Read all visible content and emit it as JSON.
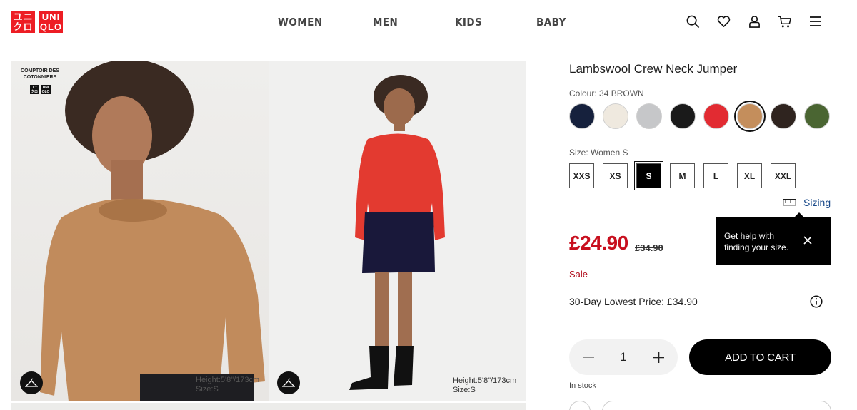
{
  "brand": {
    "logo_left": [
      "ユニ",
      "クロ"
    ],
    "logo_right": [
      "UNI",
      "QLO"
    ]
  },
  "nav": {
    "items": [
      "WOMEN",
      "MEN",
      "KIDS",
      "BABY"
    ]
  },
  "header_icons": [
    "search-icon",
    "heart-icon",
    "account-icon",
    "cart-icon",
    "menu-icon"
  ],
  "gallery": {
    "left_badge": "COMPTOIR DES COTONNIERS",
    "left_caption": [
      "Height:5'8\"/173cm",
      "Size:S"
    ],
    "right_caption": [
      "Height:5'8\"/173cm",
      "Size:S"
    ]
  },
  "product": {
    "title": "Lambswool Crew Neck Jumper",
    "colour_label": "Colour: 34 BROWN",
    "colours": [
      {
        "name": "navy",
        "hex": "#16213d"
      },
      {
        "name": "off-white",
        "hex": "#efe9df"
      },
      {
        "name": "grey",
        "hex": "#c6c7c9"
      },
      {
        "name": "black",
        "hex": "#1a1a1a"
      },
      {
        "name": "red",
        "hex": "#e22b32"
      },
      {
        "name": "brown",
        "hex": "#c48e5c",
        "selected": true
      },
      {
        "name": "dark-brown",
        "hex": "#2f241f"
      },
      {
        "name": "olive",
        "hex": "#4a6532"
      }
    ],
    "size_label": "Size: Women S",
    "sizes": [
      "XXS",
      "XS",
      "S",
      "M",
      "L",
      "XL",
      "XXL"
    ],
    "selected_size": "S",
    "sizing_link": "Sizing",
    "tooltip": [
      "Get help with",
      "finding your size."
    ],
    "price": "£24.90",
    "old_price": "£34.90",
    "sale_label": "Sale",
    "lowest_price": "30-Day Lowest Price: £34.90",
    "quantity": "1",
    "add_to_cart": "ADD TO CART",
    "stock": "In stock"
  },
  "colors": {
    "brand_red": "#ed1d24",
    "price_red": "#c80f1e"
  }
}
